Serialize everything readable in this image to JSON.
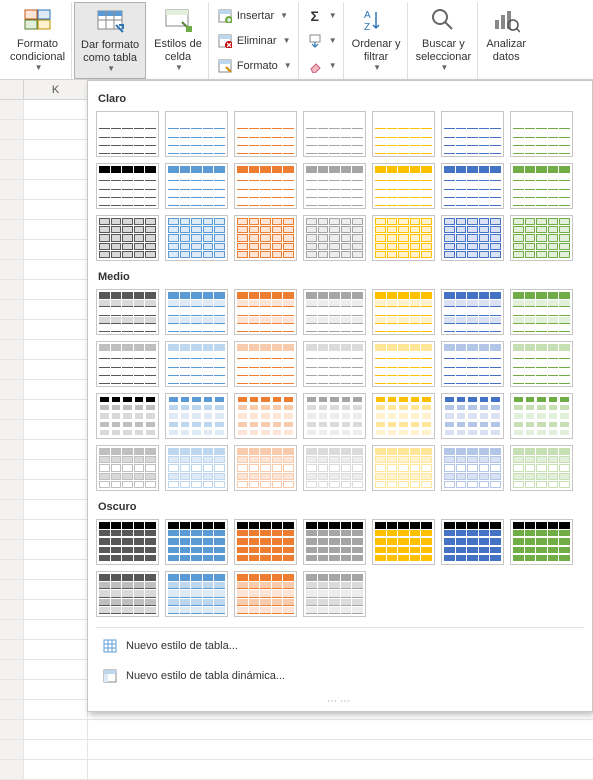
{
  "ribbon": {
    "conditional_format": "Formato\ncondicional",
    "format_as_table": "Dar formato\ncomo tabla",
    "cell_styles": "Estilos de\ncelda",
    "insert": "Insertar",
    "delete": "Eliminar",
    "format": "Formato",
    "sort_filter": "Ordenar y\nfiltrar",
    "find_select": "Buscar y\nseleccionar",
    "analyze": "Analizar\ndatos"
  },
  "column_header": "K",
  "dropdown": {
    "sections": {
      "light": "Claro",
      "medium": "Medio",
      "dark": "Oscuro"
    },
    "new_style": "Nuevo estilo de tabla...",
    "new_pivot_style": "Nuevo estilo de tabla dinámica..."
  },
  "palette": [
    "#585858",
    "#5b9bd5",
    "#ed7d31",
    "#a5a5a5",
    "#ffc000",
    "#4472c4",
    "#70ad47"
  ],
  "palette_light": [
    "#d9d9d9",
    "#deebf7",
    "#fce4d6",
    "#ededed",
    "#fff2cc",
    "#d9e1f2",
    "#e2efda"
  ],
  "palette_mid": [
    "#bfbfbf",
    "#bdd7ee",
    "#f8cbad",
    "#dbdbdb",
    "#ffe699",
    "#b4c6e7",
    "#c6e0b4"
  ]
}
